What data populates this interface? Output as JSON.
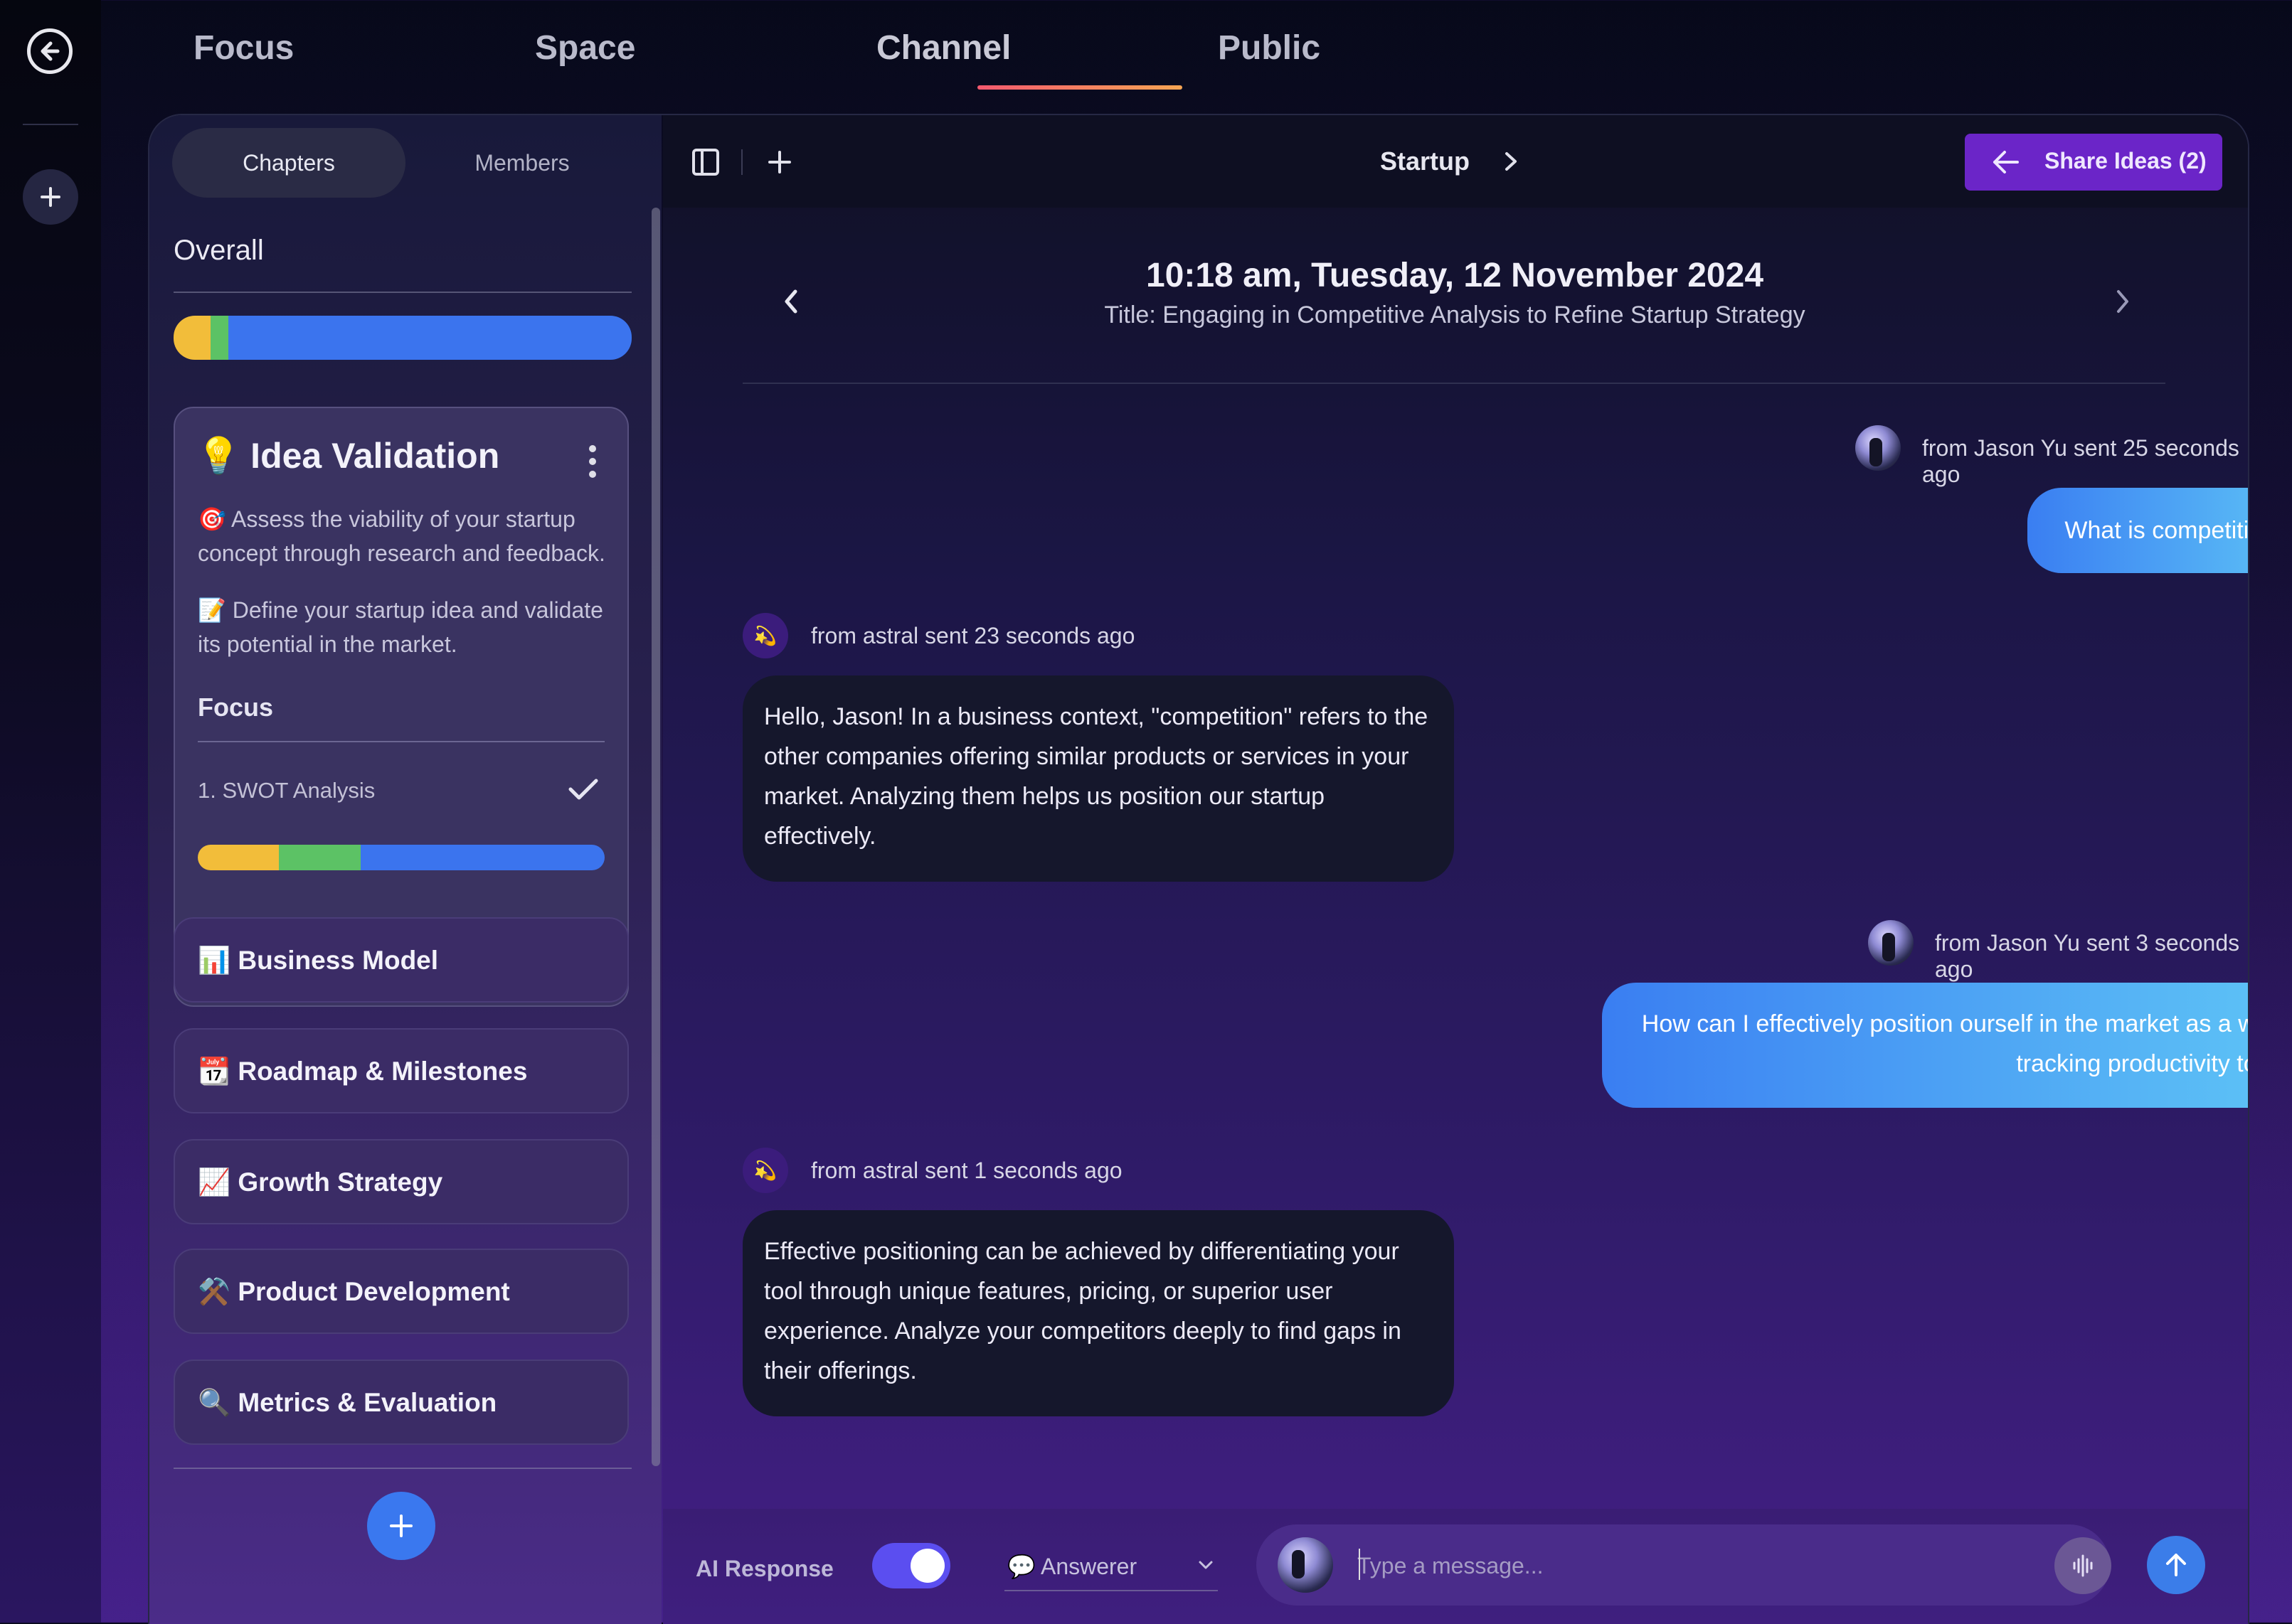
{
  "nav": {
    "tabs": [
      {
        "label": "Focus"
      },
      {
        "label": "Space"
      },
      {
        "label": "Channel"
      },
      {
        "label": "Public"
      }
    ],
    "active_tab": "Channel"
  },
  "sidebar": {
    "segment": {
      "chapters": "Chapters",
      "members": "Members",
      "active": "Chapters"
    },
    "overall_label": "Overall",
    "overall_progress": {
      "yellow": 0.08,
      "green": 0.04,
      "blue": 0.88
    },
    "active_chapter": {
      "emoji": "💡",
      "title": "Idea Validation",
      "desc1": "🎯 Assess the viability of your startup concept through research and feedback.",
      "desc2": "📝 Define your startup idea and validate its potential in the market.",
      "focus_label": "Focus",
      "focus_item": "1. SWOT Analysis",
      "progress": {
        "yellow": 0.2,
        "green": 0.2,
        "blue": 0.6
      }
    },
    "chapters": [
      {
        "label": "📊 Business Model"
      },
      {
        "label": "📆 Roadmap & Milestones"
      },
      {
        "label": "📈 Growth Strategy"
      },
      {
        "label": "⚒️ Product Development"
      },
      {
        "label": "🔍 Metrics & Evaluation"
      }
    ]
  },
  "chat": {
    "breadcrumb": "Startup",
    "share_button": "Share Ideas (2)",
    "session_date": "10:18 am, Tuesday, 12 November 2024",
    "session_title": "Title: Engaging in Competitive Analysis to Refine Startup Strategy",
    "messages": [
      {
        "from": "user",
        "meta": "from Jason Yu sent 25 seconds ago",
        "text": "What is competition?"
      },
      {
        "from": "bot",
        "meta": "from astral sent 23 seconds ago",
        "text": "Hello, Jason! In a business context, \"competition\" refers to the other companies offering similar products or services in your market. Analyzing them helps us position our startup effectively."
      },
      {
        "from": "user",
        "meta": "from Jason Yu sent 3 seconds ago",
        "text": "How can I effectively position ourself in the market as a work tracking productivity tool?"
      },
      {
        "from": "bot",
        "meta": "from astral sent 1 seconds ago",
        "text": "Effective positioning can be achieved by differentiating your tool through unique features, pricing, or superior user experience. Analyze your competitors deeply to find gaps in their offerings."
      }
    ],
    "bot_avatar_icon": "💫"
  },
  "composer": {
    "ai_label": "AI Response",
    "ai_toggle_on": true,
    "mode": "💬 Answerer",
    "placeholder": "Type a message..."
  },
  "colors": {
    "accent_purple": "#6b25c8",
    "bubble_user_start": "#3a7ef2",
    "bubble_user_end": "#5fc6f6",
    "progress_yellow": "#f2bd3a",
    "progress_green": "#5cc265",
    "progress_blue": "#3b74ee"
  }
}
